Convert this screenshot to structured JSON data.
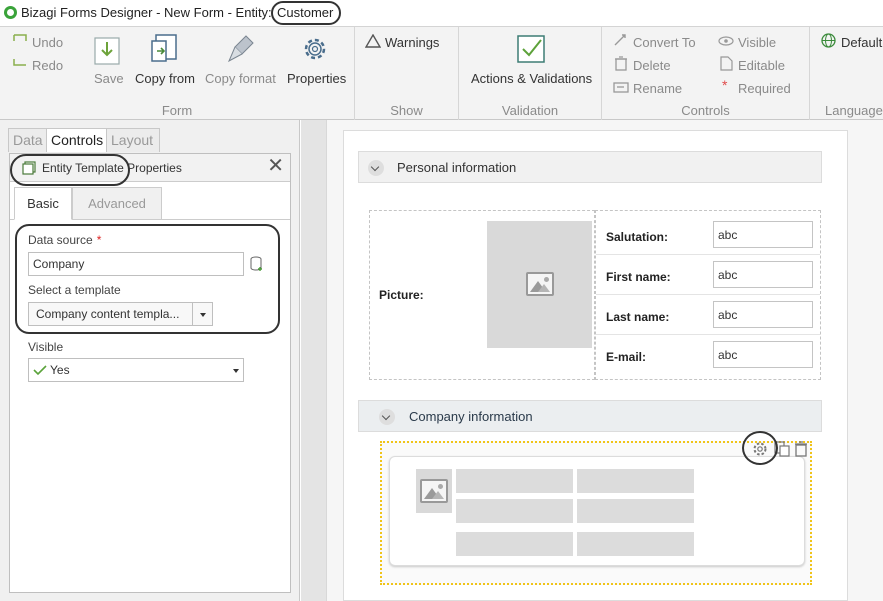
{
  "titlebar": {
    "prefix": "Bizagi Forms Designer  - New Form - Entity:",
    "entity": "Customer"
  },
  "ribbon": {
    "undo": "Undo",
    "redo": "Redo",
    "save": "Save",
    "copy_from": "Copy from",
    "copy_format": "Copy format",
    "properties": "Properties",
    "form_group": "Form",
    "warnings": "Warnings",
    "show_group": "Show",
    "actions_validations": "Actions & Validations",
    "validation_group": "Validation",
    "convert_to": "Convert To",
    "delete": "Delete",
    "rename": "Rename",
    "visible": "Visible",
    "editable": "Editable",
    "required": "Required",
    "controls_group": "Controls",
    "default": "Default",
    "languages_group": "Languages"
  },
  "leftpanel": {
    "tabs": [
      "Data",
      "Controls",
      "Layout"
    ],
    "prop_title": "Entity Template Properties",
    "subtabs": [
      "Basic",
      "Advanced"
    ],
    "data_source_label": "Data source",
    "required_mark": "*",
    "data_source_value": "Company",
    "template_label": "Select a template",
    "template_value": "Company content templa...",
    "visible_label": "Visible",
    "visible_value": "Yes"
  },
  "form": {
    "personal_title": "Personal information",
    "picture_label": "Picture:",
    "fields": [
      {
        "label": "Salutation:",
        "value": "abc"
      },
      {
        "label": "First name:",
        "value": "abc"
      },
      {
        "label": "Last name:",
        "value": "abc"
      },
      {
        "label": "E-mail:",
        "value": "abc"
      }
    ],
    "company_title": "Company information"
  },
  "colors": {
    "ribbon_bg": "#f3f3f3",
    "accent_green": "#3aa33a",
    "selection_yellow": "#f0c419",
    "required_red": "#dd2222"
  }
}
